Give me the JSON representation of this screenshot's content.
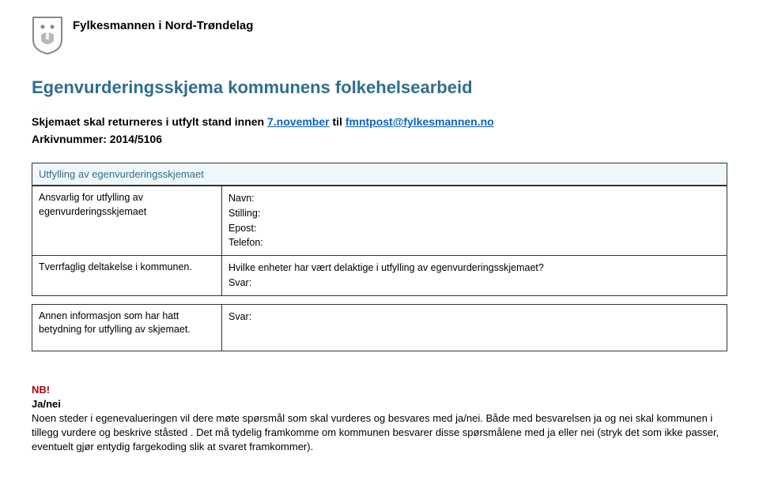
{
  "header": {
    "org_name": "Fylkesmannen i Nord-Trøndelag"
  },
  "title": "Egenvurderingsskjema kommunens folkehelsearbeid",
  "intro": {
    "prefix": "Skjemaet skal returneres i utfylt stand innen ",
    "date": "7.november",
    "mid": " til ",
    "email": "fmntpost@fylkesmannen.no"
  },
  "arkiv": "Arkivnummer: 2014/5106",
  "section_header": "Utfylling av egenvurderingsskjemaet",
  "rows": [
    {
      "left": "Ansvarlig for utfylling av egenvurderingsskjemaet",
      "right_lines": [
        "Navn:",
        "Stilling:",
        "Epost:",
        "Telefon:"
      ]
    },
    {
      "left": "Tverrfaglig deltakelse i kommunen.",
      "right_lines": [
        "Hvilke enheter har vært delaktige i utfylling av egenvurderingsskjemaet?",
        "Svar:"
      ]
    },
    {
      "left": "Annen informasjon som har hatt betydning for utfylling av skjemaet.",
      "right_lines": [
        "Svar:"
      ]
    }
  ],
  "nb": {
    "label": "NB!",
    "janei": "Ja/nei",
    "text": "Noen steder i egenevalueringen vil dere møte spørsmål som skal vurderes og besvares med ja/nei. Både med besvarelsen ja og nei skal kommunen i tillegg vurdere og beskrive ståsted . Det må tydelig framkomme om kommunen besvarer disse spørsmålene med ja eller nei (stryk det som ikke passer, eventuelt gjør entydig fargekoding slik at svaret framkommer)."
  }
}
